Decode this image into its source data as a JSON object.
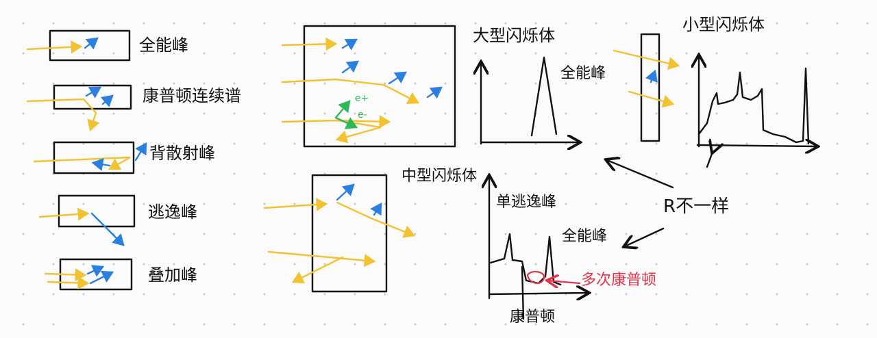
{
  "labels": {
    "full_energy_peak": "全能峰",
    "compton_continuum": "康普顿连续谱",
    "backscatter_peak": "背散射峰",
    "escape_peak": "逃逸峰",
    "sum_peak": "叠加峰",
    "large_scintillator": "大型闪烁体",
    "large_full_energy": "全能峰",
    "small_scintillator": "小型闪烁体",
    "medium_scintillator": "中型闪烁体",
    "single_escape_peak": "单逃逸峰",
    "medium_full_energy": "全能峰",
    "compton_edge": "康普顿",
    "multiple_compton": "多次康普顿",
    "r_differs": "R不一样",
    "e_plus": "e+",
    "e_minus": "e-"
  },
  "colors": {
    "gamma": "#f2c230",
    "electron": "#2a7fe0",
    "pair": "#2fb85a",
    "annotation": "#e0344b",
    "ink": "#111111"
  }
}
